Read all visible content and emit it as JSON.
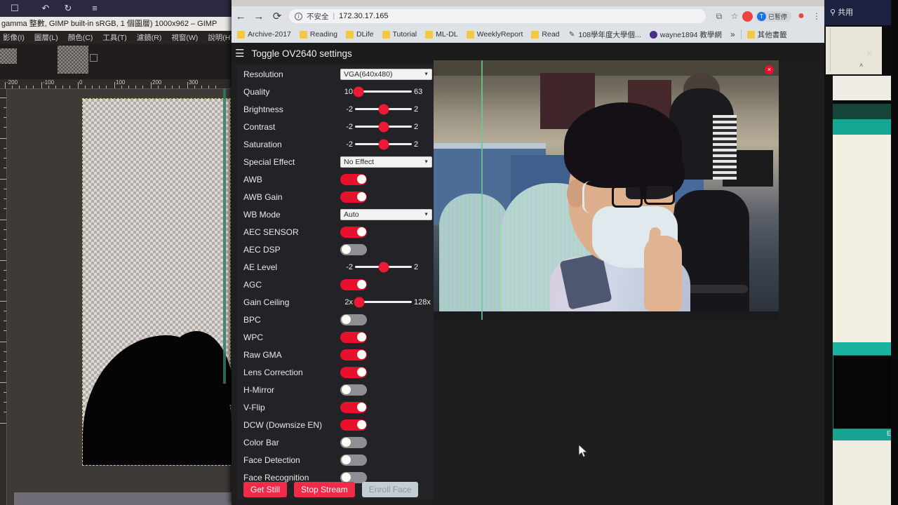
{
  "gimp": {
    "title": "gamma 整數, GIMP built-in sRGB, 1 個圖層) 1000x962 – GIMP",
    "toolbar_glyphs": [
      "☐",
      "↶",
      "↻",
      "≡"
    ],
    "menus": [
      "影像(I)",
      "圖層(L)",
      "顏色(C)",
      "工具(T)",
      "濾鏡(R)",
      "視窗(W)",
      "說明(H)"
    ],
    "ruler_labels": [
      "-200",
      "-100",
      "0",
      "100",
      "200",
      "300"
    ]
  },
  "browser": {
    "nav": {
      "back_icon": "←",
      "forward_icon": "→",
      "reload_icon": "⟳"
    },
    "omnibox": {
      "security_icon": "i",
      "security_label": "不安全",
      "separator": "|",
      "url": "172.30.17.165",
      "star_icon": "☆",
      "ext_icon": "⧉"
    },
    "profile": {
      "avatar_initial": "T",
      "label": "已暫停",
      "record_icon": "●",
      "menu_icon": "⋮"
    },
    "bookmarks": [
      {
        "label": "Archive-2017",
        "icon": "folder-icon"
      },
      {
        "label": "Reading",
        "icon": "folder-icon"
      },
      {
        "label": "DLife",
        "icon": "folder-icon"
      },
      {
        "label": "Tutorial",
        "icon": "folder-icon"
      },
      {
        "label": "ML-DL",
        "icon": "folder-icon"
      },
      {
        "label": "WeeklyReport",
        "icon": "folder-icon"
      },
      {
        "label": "Read",
        "icon": "folder-icon"
      },
      {
        "label": "108學年度大學個...",
        "icon": "pen-icon"
      },
      {
        "label": "wayne1894 教學網",
        "icon": "globe-icon"
      }
    ],
    "bookmarks_overflow": "»",
    "other_bookmarks": "其他書籤"
  },
  "app": {
    "hamburger_icon": "☰",
    "title": "Toggle OV2640 settings",
    "rows": [
      {
        "label": "Resolution",
        "type": "select",
        "value": "VGA(640x480)"
      },
      {
        "label": "Quality",
        "type": "slider",
        "min": "10",
        "max": "63",
        "percent": 6
      },
      {
        "label": "Brightness",
        "type": "slider",
        "min": "-2",
        "max": "2",
        "percent": 50
      },
      {
        "label": "Contrast",
        "type": "slider",
        "min": "-2",
        "max": "2",
        "percent": 50
      },
      {
        "label": "Saturation",
        "type": "slider",
        "min": "-2",
        "max": "2",
        "percent": 50
      },
      {
        "label": "Special Effect",
        "type": "select",
        "value": "No Effect"
      },
      {
        "label": "AWB",
        "type": "toggle",
        "state": "on"
      },
      {
        "label": "AWB Gain",
        "type": "toggle",
        "state": "on"
      },
      {
        "label": "WB Mode",
        "type": "select",
        "value": "Auto"
      },
      {
        "label": "AEC SENSOR",
        "type": "toggle",
        "state": "on"
      },
      {
        "label": "AEC DSP",
        "type": "toggle",
        "state": "off"
      },
      {
        "label": "AE Level",
        "type": "slider",
        "min": "-2",
        "max": "2",
        "percent": 50
      },
      {
        "label": "AGC",
        "type": "toggle",
        "state": "on"
      },
      {
        "label": "Gain Ceiling",
        "type": "slider",
        "min": "2x",
        "max": "128x",
        "percent": 8
      },
      {
        "label": "BPC",
        "type": "toggle",
        "state": "off"
      },
      {
        "label": "WPC",
        "type": "toggle",
        "state": "on"
      },
      {
        "label": "Raw GMA",
        "type": "toggle",
        "state": "on"
      },
      {
        "label": "Lens Correction",
        "type": "toggle",
        "state": "on"
      },
      {
        "label": "H-Mirror",
        "type": "toggle",
        "state": "off"
      },
      {
        "label": "V-Flip",
        "type": "toggle",
        "state": "on"
      },
      {
        "label": "DCW (Downsize EN)",
        "type": "toggle",
        "state": "on"
      },
      {
        "label": "Color Bar",
        "type": "toggle",
        "state": "off"
      },
      {
        "label": "Face Detection",
        "type": "toggle",
        "state": "off"
      },
      {
        "label": "Face Recognition",
        "type": "toggle",
        "state": "off"
      }
    ],
    "buttons": [
      {
        "label": "Get Still",
        "style": "primary"
      },
      {
        "label": "Stop Stream",
        "style": "primary"
      },
      {
        "label": "Enroll Face",
        "style": "ghost"
      }
    ],
    "stream": {
      "close_icon": "×"
    },
    "colors": {
      "toggle_on": "#e8112d",
      "toggle_off": "#8e8e93",
      "slider_knob": "#ec1a35",
      "button_primary": "#ef2b47",
      "panel_bg": "#232226"
    }
  },
  "right_windows": {
    "share_label": "共用",
    "share_icon": "⚲",
    "close_icon": "×",
    "caret_icon": "˄",
    "es_label": "ES"
  }
}
